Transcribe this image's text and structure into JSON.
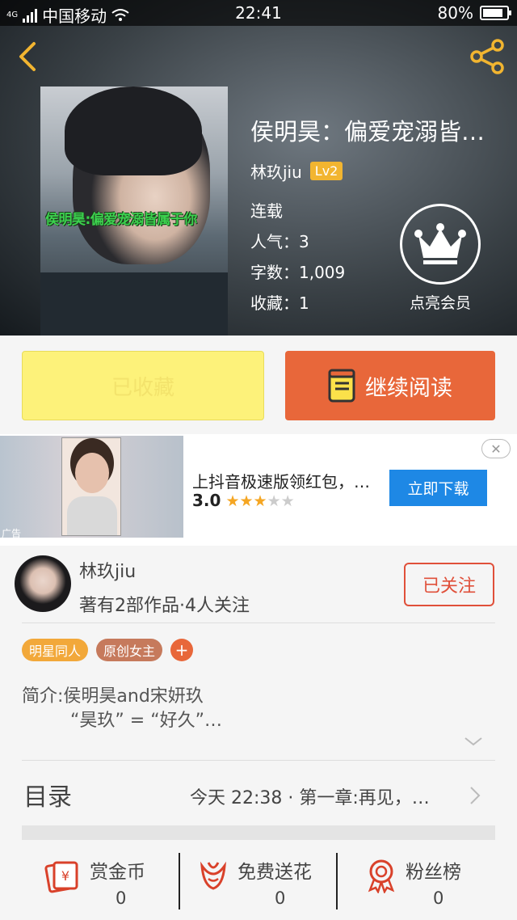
{
  "status_bar": {
    "network": "4G",
    "carrier": "中国移动",
    "time": "22:41",
    "battery_level": "80%",
    "battery_fraction": 0.8
  },
  "book": {
    "title": "侯明昊：偏爱宠溺皆…",
    "cover_text": "侯明昊:偏爱宠溺皆属于你",
    "author": "林玖jiu",
    "level": "Lv2",
    "status": "连载",
    "popularity": "人气：3",
    "word_count": "字数：1,009",
    "favorites": "收藏：1",
    "vip_label": "点亮会员"
  },
  "actions": {
    "collected_label": "已收藏",
    "read_label": "继续阅读"
  },
  "ad": {
    "title": "上抖音极速版领红包，…",
    "rating": "3.0",
    "stars_filled": 3,
    "stars_total": 5,
    "download_label": "立即下载",
    "ad_tag": "广告",
    "close_glyph": "✕"
  },
  "author_card": {
    "name": "林玖jiu",
    "works": "著有2部作品·4人关注",
    "follow_label": "已关注"
  },
  "tags": [
    {
      "label": "明星同人",
      "color": "#f2a83a"
    },
    {
      "label": "原创女主",
      "color": "#c67a5c"
    }
  ],
  "tag_add": "+",
  "intro": {
    "line1": "简介:侯明昊and宋妍玖",
    "line2": "“昊玖” = “好久”…"
  },
  "toc": {
    "label": "目录",
    "latest": "今天 22:38 · 第一章:再见，…"
  },
  "bottom_bar": [
    {
      "label": "赏金币",
      "count": "0",
      "icon": "coin-reward-icon"
    },
    {
      "label": "免费送花",
      "count": "0",
      "icon": "flower-icon"
    },
    {
      "label": "粉丝榜",
      "count": "0",
      "icon": "rank-medal-icon"
    }
  ],
  "colors": {
    "accent": "#e8673a",
    "collected_bg": "#fdf27a",
    "follow": "#e0503a",
    "download": "#1e88e5"
  }
}
